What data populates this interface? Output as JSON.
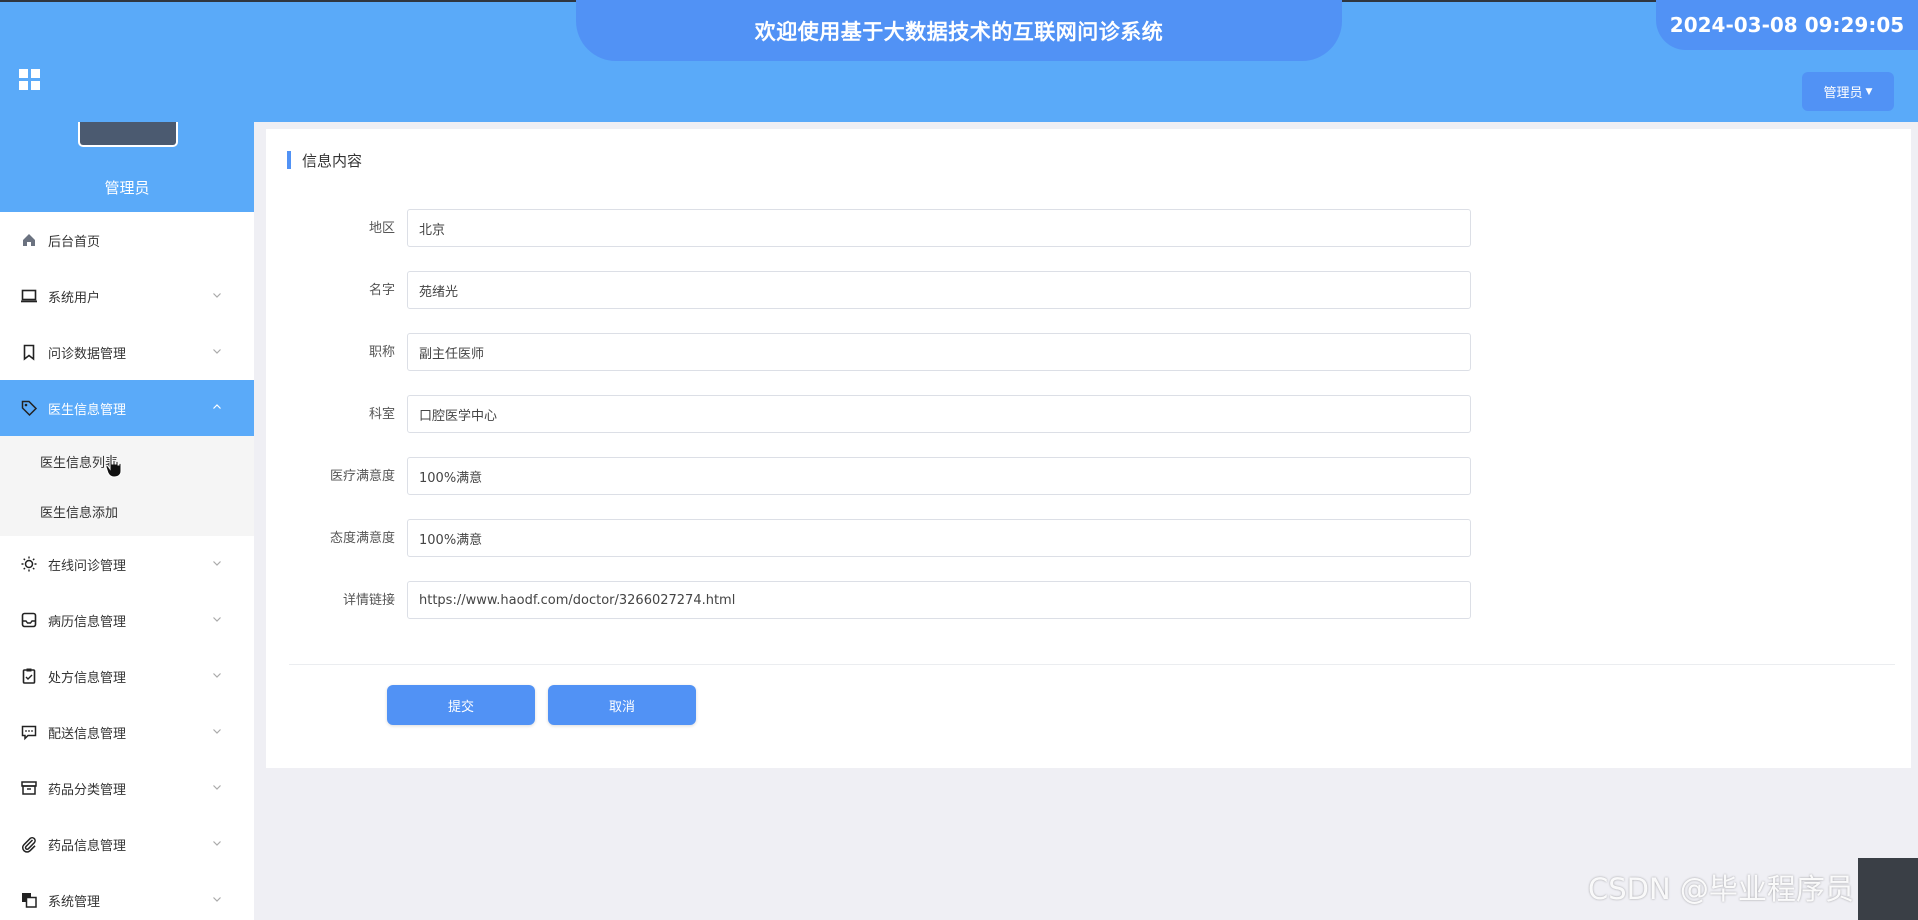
{
  "header": {
    "title": "欢迎使用基于大数据技术的互联网问诊系统",
    "datetime": "2024-03-08 09:29:05",
    "user_label": "管理员",
    "colors": {
      "primary": "#5aaaf9",
      "accent": "#5192f5"
    }
  },
  "sidebar": {
    "role": "管理员",
    "items": [
      {
        "label": "后台首页",
        "icon": "home-icon"
      },
      {
        "label": "系统用户",
        "icon": "laptop-icon"
      },
      {
        "label": "问诊数据管理",
        "icon": "bookmark-icon"
      },
      {
        "label": "医生信息管理",
        "icon": "tag-icon"
      },
      {
        "label": "在线问诊管理",
        "icon": "sun-icon"
      },
      {
        "label": "病历信息管理",
        "icon": "inbox-icon"
      },
      {
        "label": "处方信息管理",
        "icon": "clipboard-icon"
      },
      {
        "label": "配送信息管理",
        "icon": "message-icon"
      },
      {
        "label": "药品分类管理",
        "icon": "archive-icon"
      },
      {
        "label": "药品信息管理",
        "icon": "paperclip-icon"
      },
      {
        "label": "系统管理",
        "icon": "layers-icon"
      }
    ],
    "submenu": [
      {
        "label": "医生信息列表"
      },
      {
        "label": "医生信息添加"
      }
    ]
  },
  "main": {
    "title": "信息内容",
    "fields": [
      {
        "label": "地区",
        "value": "北京"
      },
      {
        "label": "名字",
        "value": "苑绪光"
      },
      {
        "label": "职称",
        "value": "副主任医师"
      },
      {
        "label": "科室",
        "value": "口腔医学中心"
      },
      {
        "label": "医疗满意度",
        "value": "100%满意"
      },
      {
        "label": "态度满意度",
        "value": "100%满意"
      },
      {
        "label": "详情链接",
        "value": "https://www.haodf.com/doctor/3266027274.html"
      }
    ],
    "submit_label": "提交",
    "cancel_label": "取消"
  },
  "watermark": "CSDN @毕业程序员"
}
